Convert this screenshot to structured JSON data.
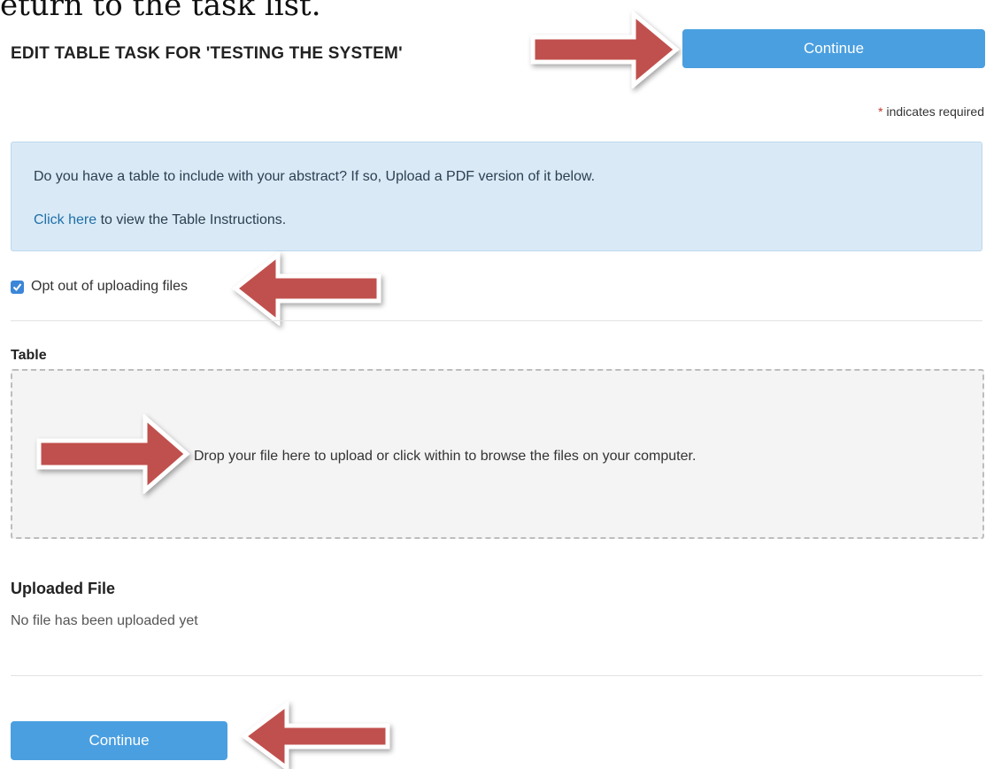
{
  "caption": "eturn to the task list.",
  "task_title": "EDIT TABLE TASK FOR 'TESTING THE SYSTEM'",
  "continue_top_label": "Continue",
  "required_star": "*",
  "required_text": " indicates required",
  "info": {
    "line1": "Do you have a table to include with your abstract? If so, Upload a PDF version of it below.",
    "link_text": "Click here",
    "line2_rest": " to view the Table Instructions."
  },
  "optout": {
    "checked": true,
    "label": "Opt out of uploading files"
  },
  "table_label": "Table",
  "dropzone_text": "Drop your file here to upload or click within to browse the files on your computer.",
  "uploaded": {
    "heading": "Uploaded File",
    "status": "No file has been uploaded yet"
  },
  "continue_bottom_label": "Continue",
  "colors": {
    "button": "#4a9fe0",
    "info_bg": "#d9eaf6",
    "arrow": "#c0504d"
  }
}
